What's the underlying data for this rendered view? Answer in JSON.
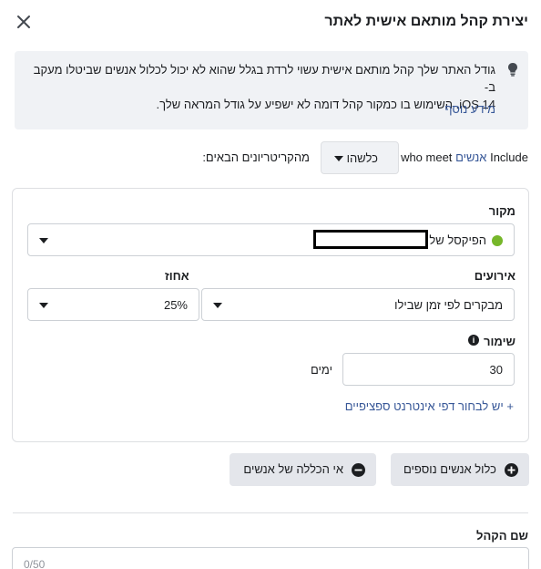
{
  "dialog": {
    "title": "יצירת קהל מותאם אישית לאתר",
    "close_icon": "close-icon"
  },
  "info_box": {
    "icon": "lightbulb-icon",
    "text_line1": "גודל האתר שלך קהל מותאם אישית עשוי לרדת בגלל שהוא לא יכול לכלול אנשים שביטלו מעקב ב-",
    "text_line2": "iOS 14. השימוש בו כמקור קהל דומה לא ישפיע על גודל המראה שלך.",
    "link": "מידע נוסף"
  },
  "include_row": {
    "include_word": "Include",
    "people_word": "אנשים",
    "who_meet": "who meet",
    "any_dropdown_value": "כלשהו",
    "criteria_suffix": "מהקריטריונים הבאים:"
  },
  "rule_card": {
    "source_label": "מקור",
    "source_value": "הפיקסל של",
    "source_status_color": "#76b72a",
    "events_label": "אירועים",
    "events_value": "מבקרים לפי זמן שבילו",
    "percent_label": "אחוז",
    "percent_value": "25%",
    "retention_label": "שימור",
    "retention_value": "30",
    "retention_unit": "ימים",
    "add_pages_link": "+ יש לבחור דפי אינטרנט ספציפיים"
  },
  "actions": {
    "include_more": "כלול אנשים נוספים",
    "exclude": "אי הכללה של אנשים"
  },
  "audience_name": {
    "label": "שם הקהל",
    "counter": "0/50"
  },
  "colors": {
    "link": "#385898",
    "panel_bg": "#f0f2f5",
    "button_bg": "#e4e6eb"
  }
}
